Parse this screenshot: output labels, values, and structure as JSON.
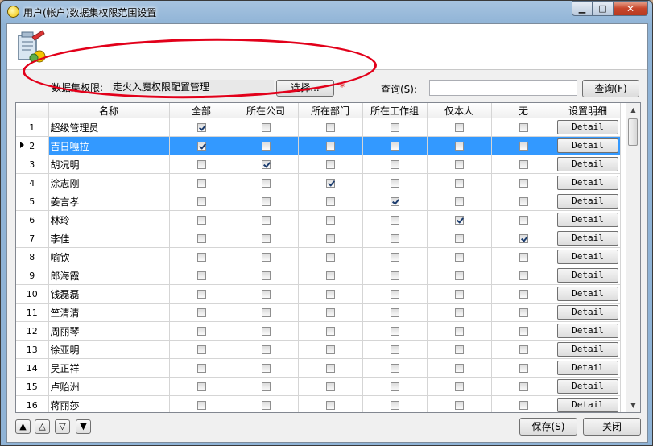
{
  "window": {
    "title": "用户(帐户)数据集权限范围设置",
    "buttons": {
      "minimize": "▁",
      "maximize": "□",
      "close": "✕"
    }
  },
  "filter": {
    "label": "数据集权限:",
    "value": "走火入魔权限配置管理",
    "select_button": "选择...",
    "required_mark": "*"
  },
  "search": {
    "label": "查询(S):",
    "value": "",
    "button": "查询(F)"
  },
  "grid": {
    "columns": [
      "名称",
      "全部",
      "所在公司",
      "所在部门",
      "所在工作组",
      "仅本人",
      "无",
      "设置明细"
    ],
    "detail_label": "Detail",
    "selected_row": 2,
    "rows": [
      {
        "no": "1",
        "name": "超级管理员",
        "checks": [
          true,
          false,
          false,
          false,
          false,
          false
        ]
      },
      {
        "no": "2",
        "name": "吉日嘎拉",
        "checks": [
          true,
          false,
          false,
          false,
          false,
          false
        ]
      },
      {
        "no": "3",
        "name": "胡况明",
        "checks": [
          false,
          true,
          false,
          false,
          false,
          false
        ]
      },
      {
        "no": "4",
        "name": "涂志刚",
        "checks": [
          false,
          false,
          true,
          false,
          false,
          false
        ]
      },
      {
        "no": "5",
        "name": "姜言孝",
        "checks": [
          false,
          false,
          false,
          true,
          false,
          false
        ]
      },
      {
        "no": "6",
        "name": "林玲",
        "checks": [
          false,
          false,
          false,
          false,
          true,
          false
        ]
      },
      {
        "no": "7",
        "name": "李佳",
        "checks": [
          false,
          false,
          false,
          false,
          false,
          true
        ]
      },
      {
        "no": "8",
        "name": "喻钦",
        "checks": [
          false,
          false,
          false,
          false,
          false,
          false
        ]
      },
      {
        "no": "9",
        "name": "郎海霞",
        "checks": [
          false,
          false,
          false,
          false,
          false,
          false
        ]
      },
      {
        "no": "10",
        "name": "钱磊磊",
        "checks": [
          false,
          false,
          false,
          false,
          false,
          false
        ]
      },
      {
        "no": "11",
        "name": "竺清清",
        "checks": [
          false,
          false,
          false,
          false,
          false,
          false
        ]
      },
      {
        "no": "12",
        "name": "周丽琴",
        "checks": [
          false,
          false,
          false,
          false,
          false,
          false
        ]
      },
      {
        "no": "13",
        "name": "徐亚明",
        "checks": [
          false,
          false,
          false,
          false,
          false,
          false
        ]
      },
      {
        "no": "14",
        "name": "吴正祥",
        "checks": [
          false,
          false,
          false,
          false,
          false,
          false
        ]
      },
      {
        "no": "15",
        "name": "卢贻洲",
        "checks": [
          false,
          false,
          false,
          false,
          false,
          false
        ]
      },
      {
        "no": "16",
        "name": "蒋丽莎",
        "checks": [
          false,
          false,
          false,
          false,
          false,
          false
        ]
      }
    ]
  },
  "nav": {
    "first": "▲",
    "prev": "△",
    "next": "▽",
    "last": "▼"
  },
  "footer": {
    "save": "保存(S)",
    "close": "关闭"
  },
  "colors": {
    "selection": "#3399ff",
    "annotation": "#e2001a",
    "required": "#e00000"
  }
}
